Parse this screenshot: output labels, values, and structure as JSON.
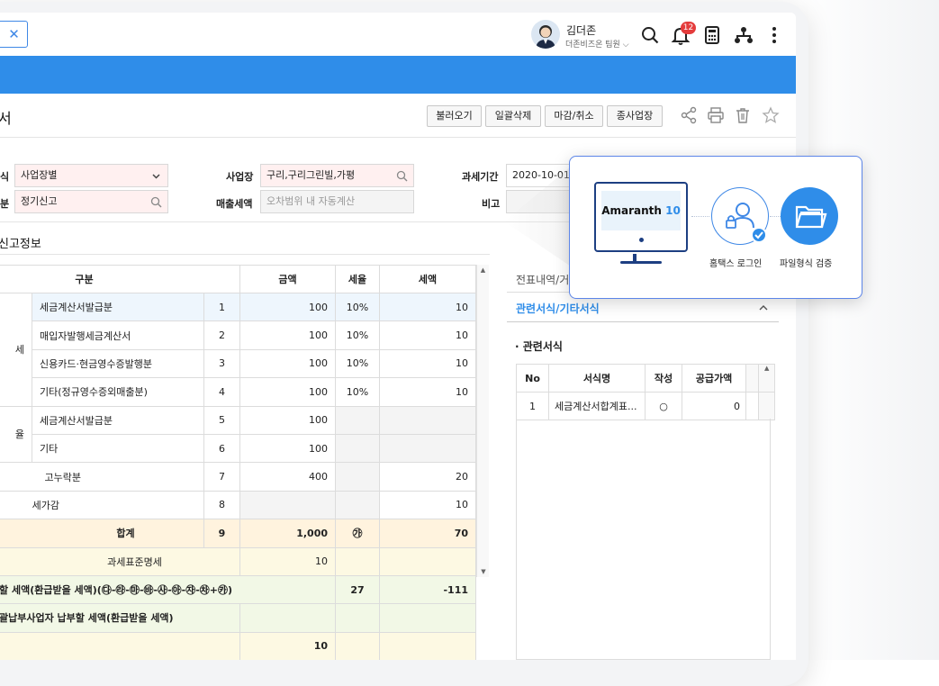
{
  "header": {
    "user_name": "김더존",
    "user_org": "더존비즈온 팀원",
    "notification_count": "12"
  },
  "toolbar": {
    "title": "서",
    "buttons": [
      "불러오기",
      "일괄삭제",
      "마감/취소",
      "종사업장"
    ]
  },
  "form": {
    "label_type": "식",
    "value_type": "사업장별",
    "label_workplace": "사업장",
    "value_workplace": "구리,구리그린빌,가평",
    "label_period": "과세기간",
    "value_period": "2020-10-01",
    "label_report": "분",
    "value_report": "정기신고",
    "label_sales_tax": "매출세액",
    "placeholder_sales_tax": "오차범위 내 자동계산",
    "label_note": "비고"
  },
  "section_title": "신고정보",
  "table": {
    "headers": [
      "구분",
      "금액",
      "세율",
      "세액"
    ],
    "rows": [
      {
        "group": "",
        "item": "세금계산서발급분",
        "no": "1",
        "amount": "100",
        "rate": "10%",
        "tax": "10"
      },
      {
        "group": "세",
        "item": "매입자발행세금계산서",
        "no": "2",
        "amount": "100",
        "rate": "10%",
        "tax": "10"
      },
      {
        "group": "",
        "item": "신용카드·현금영수증발행분",
        "no": "3",
        "amount": "100",
        "rate": "10%",
        "tax": "10"
      },
      {
        "group": "",
        "item": "기타(정규영수증외매출분)",
        "no": "4",
        "amount": "100",
        "rate": "10%",
        "tax": "10"
      },
      {
        "group": "",
        "item": "세금계산서발급분",
        "no": "5",
        "amount": "100",
        "rate": "",
        "tax": ""
      },
      {
        "group": "율",
        "item": "기타",
        "no": "6",
        "amount": "100",
        "rate": "",
        "tax": ""
      },
      {
        "group": "",
        "item": "고누락분",
        "no": "7",
        "amount": "400",
        "rate": "",
        "tax": "20"
      },
      {
        "group": "",
        "item": "세가감",
        "no": "8",
        "amount": "",
        "rate": "",
        "tax": "10"
      }
    ],
    "total": {
      "label": "합계",
      "no": "9",
      "amount": "1,000",
      "rate": "㉮",
      "tax": "70"
    },
    "std_label": "과세표준명세",
    "std_value": "10",
    "payable_label": "할 세액(환급받을 세액)(㉰-㉱-㉲-㉳-㉴-㉵-㉶-㉷+㉸)",
    "payable_no": "27",
    "payable_value": "-111",
    "total_payable_label": "괄납부사업자 납부할 세액(환급받을 세액)",
    "last_value": "10"
  },
  "right_panel": {
    "tab": "전표내역/거",
    "heading": "관련서식/기타서식",
    "subheading": "· 관련서식",
    "headers": [
      "No",
      "서식명",
      "작성",
      "공급가액"
    ],
    "rows": [
      {
        "no": "1",
        "name": "세금계산서합계표...",
        "written": "○",
        "amount": "0"
      }
    ]
  },
  "popup": {
    "brand": "Amaranth",
    "brand_num": "10",
    "step1": "홈택스 로그인",
    "step2": "파일형식 검증"
  },
  "colors": {
    "accent": "#2f8de9",
    "popup_border": "#5c85e8",
    "pink_field": "#fff0f0"
  }
}
